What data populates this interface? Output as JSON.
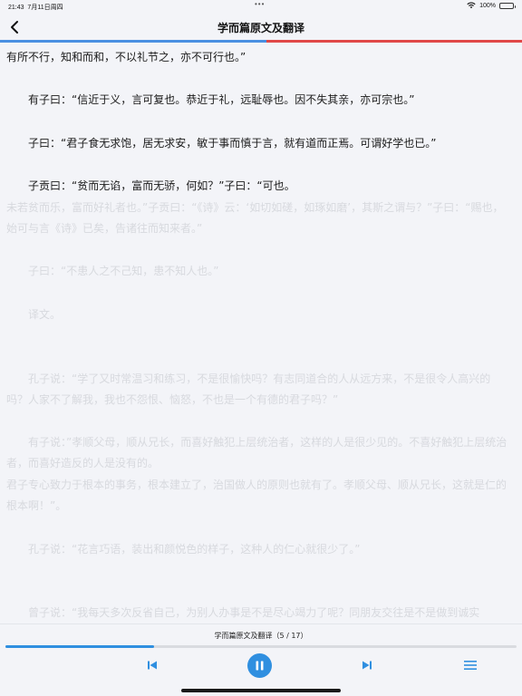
{
  "status": {
    "time": "21:43",
    "date": "7月11日周四",
    "battery": "100%",
    "wifi_icon": "wifi-icon",
    "battery_level": 1.0
  },
  "nav": {
    "title": "学而篇原文及翻译",
    "back_icon": "chevron-left-icon",
    "progress": 0.51,
    "progress_color": "#4a90e2",
    "remaining_color": "#e04848"
  },
  "paragraphs": [
    {
      "text": "有所不行，知和而和，不以礼节之，亦不可行也。”",
      "style": "normal"
    },
    {
      "text": "　　有子曰：“信近于义，言可复也。恭近于礼，远耻辱也。因不失其亲，亦可宗也。”",
      "style": "normal"
    },
    {
      "text": "　　子曰：“君子食无求饱，居无求安，敏于事而慎于言，就有道而正焉。可谓好学也已。”",
      "style": "normal"
    },
    {
      "text": "　　子贡曰：“贫而无谄，富而无骄，何如？”子曰：“可也。",
      "style": "normal"
    },
    {
      "text": "未若贫而乐，富而好礼者也。”子贡曰：“《诗》云：‘如切如磋，如琢如磨’，其斯之谓与？”子曰：“赐也，始可与言《诗》已矣，告诸往而知来者。”",
      "style": "dim"
    },
    {
      "text": "　　子曰：“不患人之不己知，患不知人也。”",
      "style": "dim"
    },
    {
      "text": "　　译文。",
      "style": "dim"
    },
    {
      "text": "　　孔子说：“学了又时常温习和练习，不是很愉快吗？有志同道合的人从远方来，不是很令人高兴的吗？人家不了解我，我也不怨恨、恼怒，不也是一个有德的君子吗？”",
      "style": "dim"
    },
    {
      "text": "　　有子说：”孝顺父母，顺从兄长，而喜好触犯上层统治者，这样的人是很少见的。不喜好触犯上层统治者，而喜好造反的人是没有的。",
      "style": "dim"
    },
    {
      "text": "君子专心致力于根本的事务，根本建立了，治国做人的原则也就有了。孝顺父母、顺从兄长，这就是仁的根本啊！”。",
      "style": "dim"
    },
    {
      "text": "　　孔子说：“花言巧语，装出和颜悦色的样子，这种人的仁心就很少了。”",
      "style": "dim"
    },
    {
      "text": "　　曾子说：“我每天多次反省自己，为别人办事是不是尽心竭力了呢？同朋友交往是不是做到诚实",
      "style": "dim"
    }
  ],
  "player": {
    "title": "学而篇原文及翻译",
    "counter": "（5 / 17）",
    "progress": 0.29,
    "accent": "#2f8fe0",
    "prev_icon": "skip-previous-icon",
    "play_icon": "pause-icon",
    "next_icon": "skip-next-icon",
    "menu_icon": "menu-icon"
  }
}
